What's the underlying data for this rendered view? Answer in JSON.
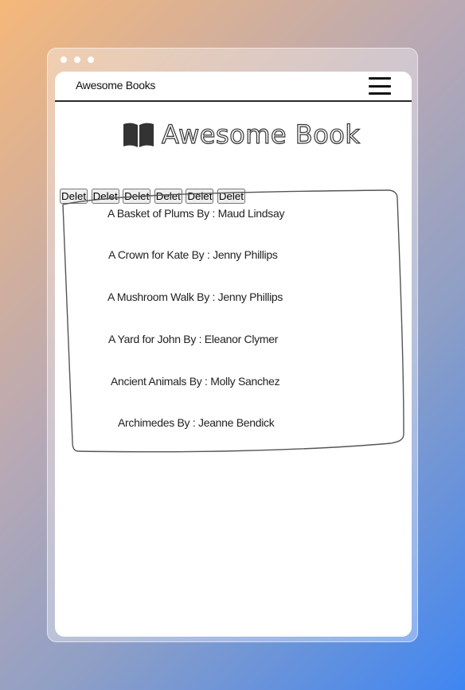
{
  "window": {
    "dots": [
      "dot",
      "dot",
      "dot"
    ]
  },
  "navbar": {
    "brand": "Awesome Books",
    "menu_icon": "hamburger-menu-icon"
  },
  "page": {
    "title": "Awesome Book",
    "title_icon": "open-book-icon"
  },
  "books": [
    {
      "text": "A Basket of Plums By : Maud Lindsay",
      "button": "Delet"
    },
    {
      "text": "A Crown for Kate By : Jenny Phillips",
      "button": "Delet"
    },
    {
      "text": "A Mushroom Walk By : Jenny Phillips",
      "button": "Delet"
    },
    {
      "text": "A Yard for John By : Eleanor Clymer",
      "button": "Delet"
    },
    {
      "text": "Ancient Animals By : Molly Sanchez",
      "button": "Delet"
    },
    {
      "text": "Archimedes By : Jeanne Bendick",
      "button": "Delet"
    }
  ],
  "colors": {
    "delete_button": "#dd3347",
    "page_background": "#ffffff"
  }
}
